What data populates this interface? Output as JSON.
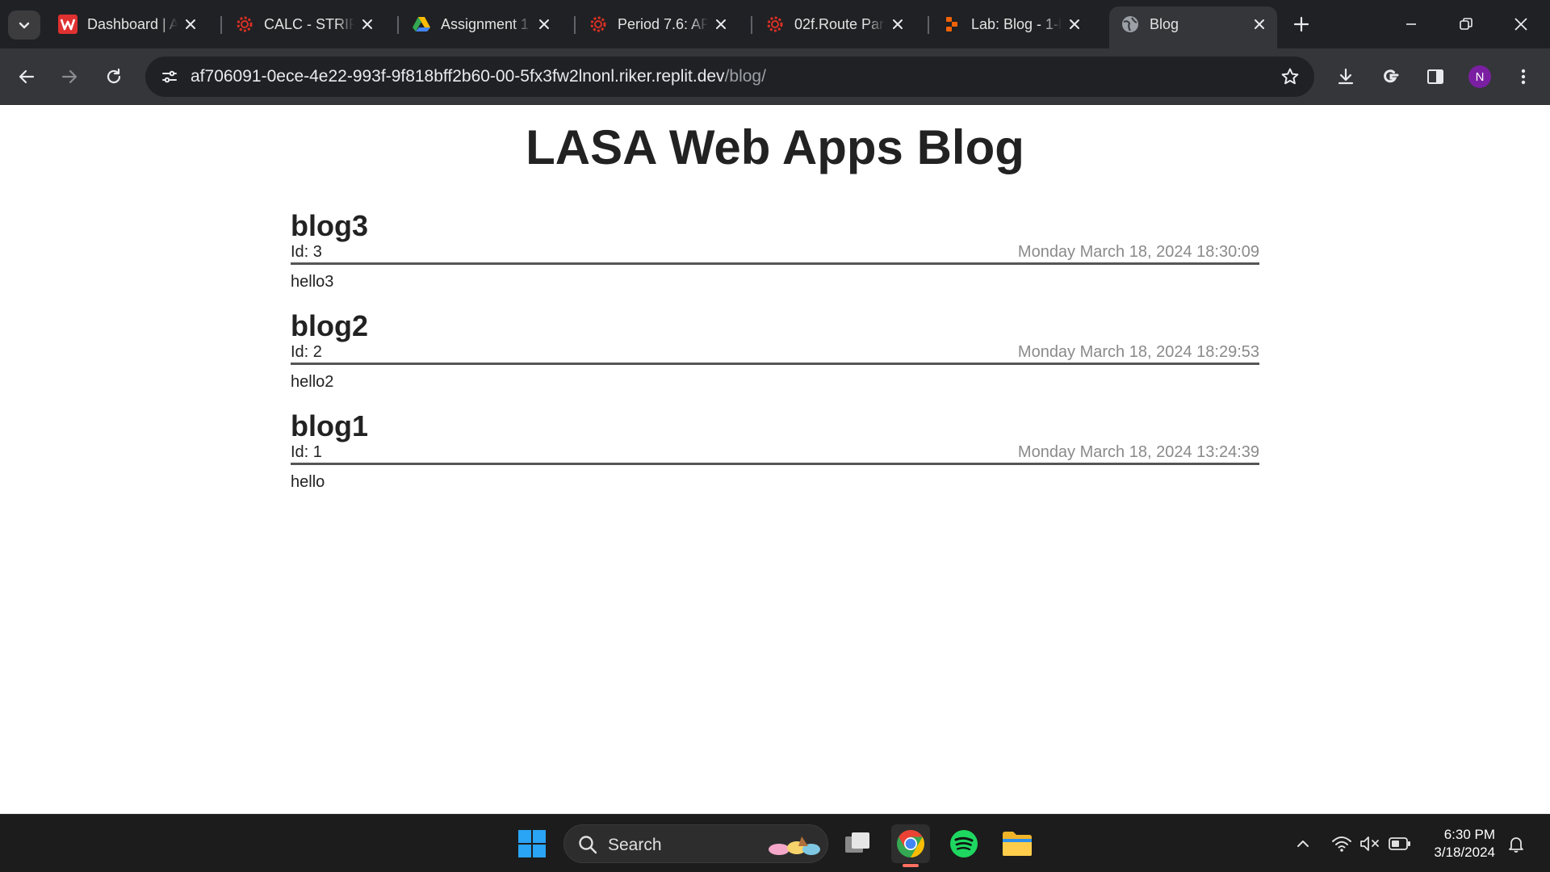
{
  "browser": {
    "tabs": [
      {
        "title": "Dashboard | A",
        "favicon": "brand-w-icon",
        "active": false
      },
      {
        "title": "CALC - STRIPL",
        "favicon": "gear-red-icon",
        "active": false
      },
      {
        "title": "Assignment 1",
        "favicon": "google-drive-icon",
        "active": false
      },
      {
        "title": "Period 7.6: AP",
        "favicon": "gear-red-icon",
        "active": false
      },
      {
        "title": "02f.Route Para",
        "favicon": "gear-red-icon",
        "active": false
      },
      {
        "title": "Lab: Blog - 1-l",
        "favicon": "replit-icon",
        "active": false
      },
      {
        "title": "Blog",
        "favicon": "globe-icon",
        "active": true
      }
    ],
    "url_host": "af706091-0ece-4e22-993f-9f818bff2b60-00-5fx3fw2lnonl.riker.replit.dev",
    "url_path": "/blog/",
    "profile_initial": "N"
  },
  "page": {
    "heading": "LASA Web Apps Blog",
    "posts": [
      {
        "title": "blog3",
        "id_label": "Id: 3",
        "date": "Monday March 18, 2024 18:30:09",
        "body": "hello3"
      },
      {
        "title": "blog2",
        "id_label": "Id: 2",
        "date": "Monday March 18, 2024 18:29:53",
        "body": "hello2"
      },
      {
        "title": "blog1",
        "id_label": "Id: 1",
        "date": "Monday March 18, 2024 13:24:39",
        "body": "hello"
      }
    ]
  },
  "taskbar": {
    "search_label": "Search",
    "time": "6:30 PM",
    "date": "3/18/2024"
  },
  "colors": {
    "browser_frame": "#202124",
    "toolbar": "#35363a",
    "post_rule": "#555555",
    "date_text": "#8a8a8a"
  }
}
